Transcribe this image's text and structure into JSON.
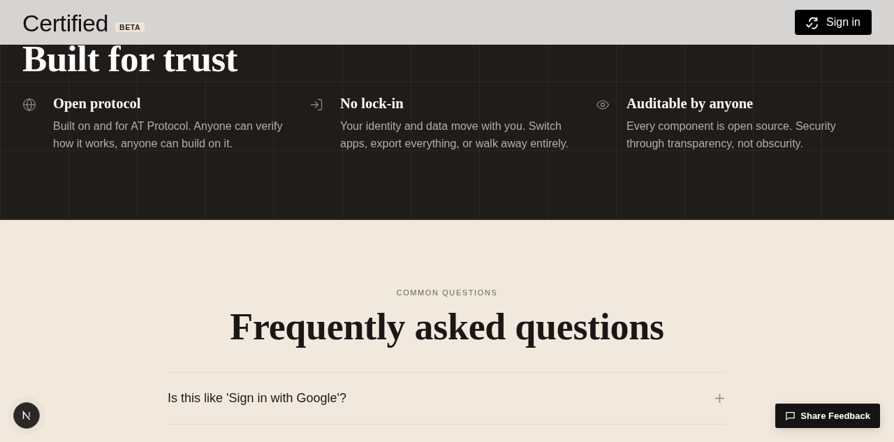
{
  "header": {
    "logo": "Certified",
    "badge": "BETA",
    "sign_in": "Sign in"
  },
  "trust": {
    "title": "Built for trust",
    "features": [
      {
        "title": "Open protocol",
        "description": "Built on and for AT Protocol. Anyone can verify how it works, anyone can build on it."
      },
      {
        "title": "No lock-in",
        "description": "Your identity and data move with you. Switch apps, export everything, or walk away entirely."
      },
      {
        "title": "Auditable by anyone",
        "description": "Every component is open source. Security through transparency, not obscurity."
      }
    ]
  },
  "faq": {
    "eyebrow": "COMMON QUESTIONS",
    "title": "Frequently asked questions",
    "items": [
      {
        "question": "Is this like 'Sign in with Google'?",
        "expanded": false
      }
    ]
  },
  "feedback_button": "Share Feedback"
}
